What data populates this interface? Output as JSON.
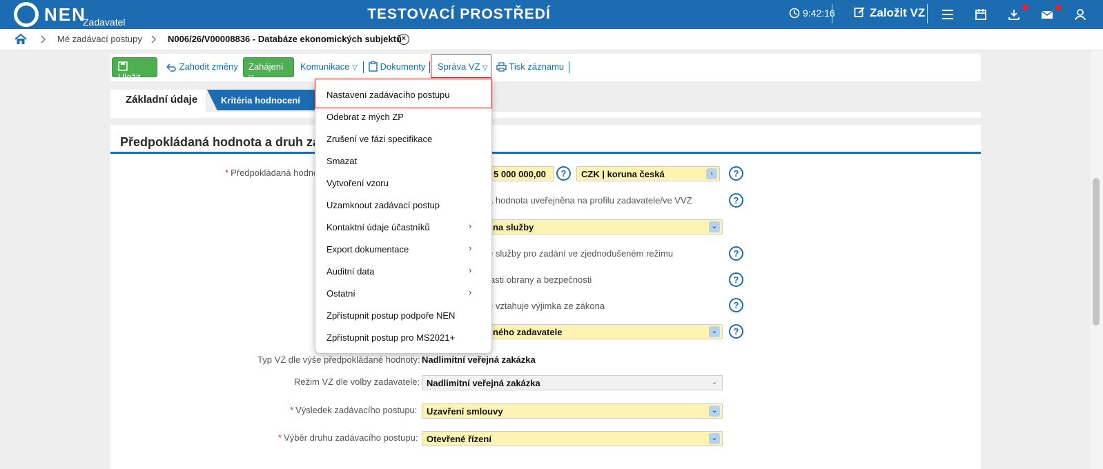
{
  "header": {
    "logo_text": "NEN",
    "logo_sub": "Zadavatel",
    "env_title": "TESTOVACÍ PROSTŘEDÍ",
    "clock": "9:42:16",
    "create_label": "Založit VZ",
    "accent": "#1b6cb0"
  },
  "breadcrumb": {
    "item1": "Mé zadávací postupy",
    "item2": "N006/26/V00008836 - Databáze ekonomických subjektů"
  },
  "toolbar": {
    "save": "Uložit",
    "discard": "Zahodit změny",
    "start": "Zahájení",
    "communication": "Komunikace",
    "documents": "Dokumenty",
    "manage": "Správa VZ",
    "print": "Tisk záznamu"
  },
  "tabs": {
    "basic": "Základní údaje",
    "criteria": "Kritéria hodnocení"
  },
  "section": {
    "title": "Předpokládaná hodnota a druh zadá"
  },
  "form": {
    "value_label": "Předpokládaná hodno",
    "value_amount": "5 000 000,00",
    "currency": "CZK | koruna česká",
    "published_text": "á hodnota uveřejněna na profilu zadavatele/ve VVZ",
    "kind_value": "na služby",
    "simplified_text": "é služby pro zadání ve zjednodušeném režimu",
    "defense_text": "lasti obrany a bezpečnosti",
    "exception_text": "e vztahuje výjimka ze zákona",
    "contracting_value": "ného zadavatele",
    "type_label": "Typ VZ dle výše předpokládané hodnoty:",
    "type_value": "Nadlimitní veřejná zakázka",
    "mode_label": "Režim VZ dle volby zadavatele:",
    "mode_value": "Nadlimitní veřejná zakázka",
    "result_label": "Výsledek zadávacího postupu:",
    "result_value": "Uzavření smlouvy",
    "procedure_label": "Výběr druhu zadávacího postupu:",
    "procedure_value": "Otevřené řízení"
  },
  "menu": {
    "items": [
      "Nastavení zadávacího postupu",
      "Odebrat z mých ZP",
      "Zrušení ve fázi specifikace",
      "Smazat",
      "Vytvoření vzoru",
      "Uzamknout zadávací postup",
      "Kontaktní údaje účastníků",
      "Export dokumentace",
      "Auditní data",
      "Ostatní",
      "Zpřístupnit postup podpoře NEN",
      "Zpřístupnit postup pro MS2021+"
    ]
  }
}
